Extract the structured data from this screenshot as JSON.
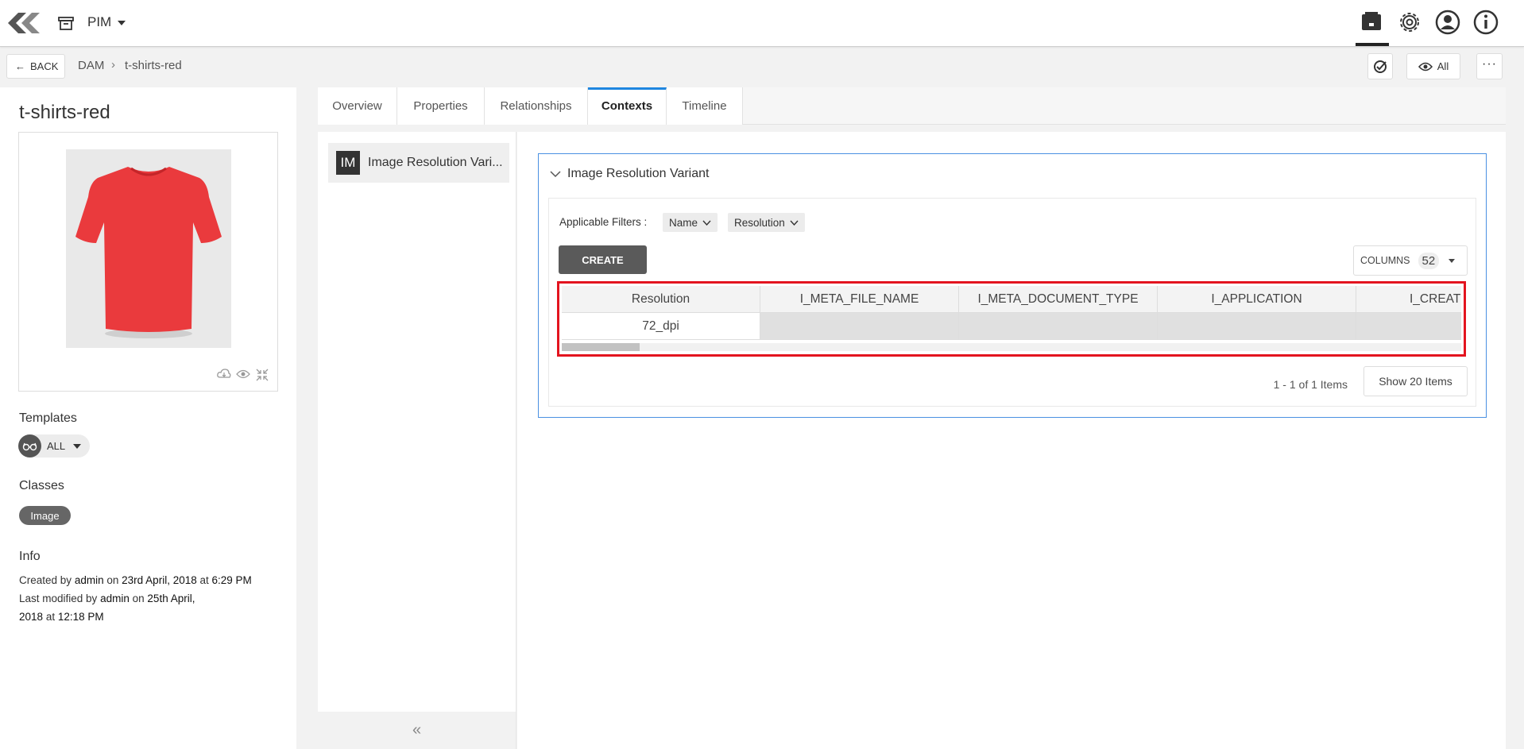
{
  "topbar": {
    "app_name": "PIM",
    "icons": [
      "logo-icon",
      "archive-icon",
      "app-switcher-icon",
      "gear-icon",
      "user-icon",
      "info-icon"
    ]
  },
  "breadcrumb": {
    "back_label": "BACK",
    "items": [
      "DAM",
      "t-shirts-red"
    ],
    "separator": "›"
  },
  "toolbar": {
    "view_label": "All"
  },
  "entity": {
    "title": "t-shirts-red",
    "image_color": "#e8383b",
    "templates_label": "Templates",
    "template_value": "ALL",
    "classes_label": "Classes",
    "class_value": "Image",
    "info_label": "Info",
    "info": {
      "created_prefix": "Created by",
      "created_by": "admin",
      "on1": "on",
      "created_date": "23rd April, 2018",
      "at1": "at",
      "created_time": "6:29 PM",
      "modified_prefix": "Last modified by",
      "modified_by": "admin",
      "on2": "on",
      "modified_date_part1": "25th April,",
      "modified_date_part2": "2018",
      "at2": "at",
      "modified_time": "12:18 PM"
    }
  },
  "tabs": [
    {
      "label": "Overview",
      "active": false
    },
    {
      "label": "Properties",
      "active": false
    },
    {
      "label": "Relationships",
      "active": false
    },
    {
      "label": "Contexts",
      "active": true
    },
    {
      "label": "Timeline",
      "active": false
    }
  ],
  "contexts": {
    "items": [
      {
        "badge": "IM",
        "label": "Image Resolution Vari..."
      }
    ],
    "collapse_glyph": "«"
  },
  "variant": {
    "title": "Image Resolution Variant",
    "filters_label": "Applicable Filters :",
    "filters": [
      "Name",
      "Resolution"
    ],
    "create_label": "CREATE",
    "columns_label": "COLUMNS",
    "columns_count": "52",
    "grid": {
      "headers": [
        "Resolution",
        "I_META_FILE_NAME",
        "I_META_DOCUMENT_TYPE",
        "I_APPLICATION",
        "I_CREATE_"
      ],
      "rows": [
        [
          "72_dpi",
          "",
          "",
          "",
          ""
        ]
      ]
    },
    "pager_text": "1 - 1 of 1 Items",
    "show_label": "Show 20 Items"
  },
  "colors": {
    "accent": "#1f86e0",
    "highlight": "#e3141f",
    "create_button": "#5a5a5a"
  }
}
